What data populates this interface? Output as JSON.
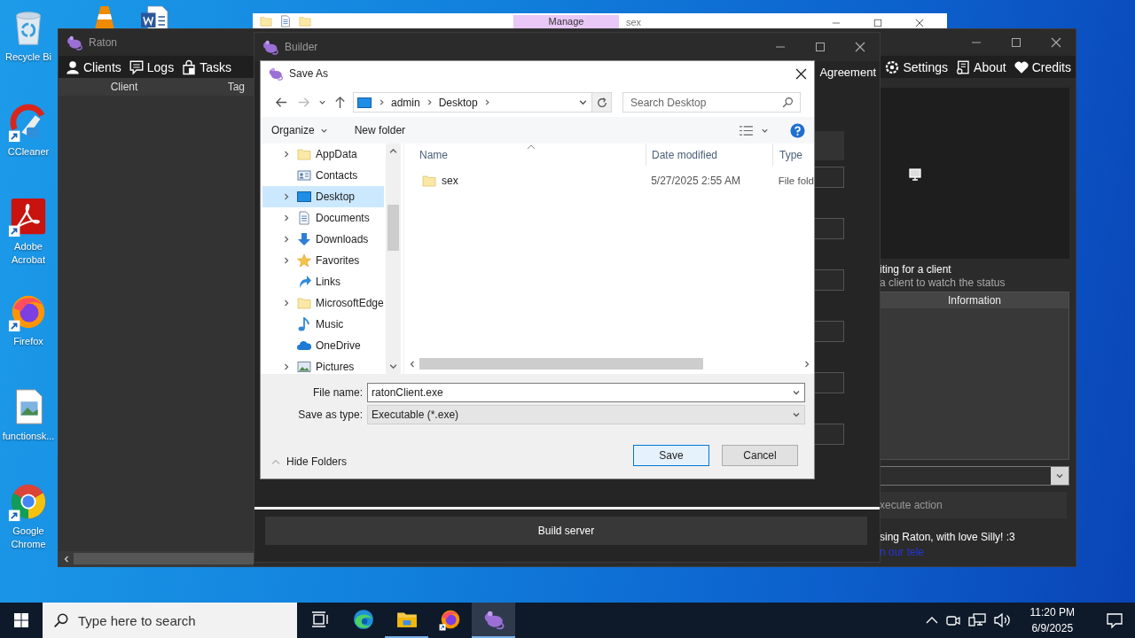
{
  "desktop_icons": [
    {
      "kind": "recycle-bin",
      "label": "Recycle Bi"
    },
    {
      "kind": "ccleaner",
      "label": "CCleaner"
    },
    {
      "kind": "acrobat",
      "label": "Adobe Acrobat"
    },
    {
      "kind": "firefox",
      "label": "Firefox"
    },
    {
      "kind": "image-file",
      "label": "functionsk..."
    },
    {
      "kind": "chrome",
      "label": "Google Chrome"
    }
  ],
  "desktop_icons_covered": [
    {
      "kind": "vlc"
    },
    {
      "kind": "word"
    }
  ],
  "explorer_window": {
    "title": "sex",
    "ribbon_tab": "Manage"
  },
  "raton_window": {
    "title": "Raton",
    "menu_left": [
      {
        "kind": "user",
        "label": "Clients"
      },
      {
        "kind": "chat",
        "label": "Logs"
      },
      {
        "kind": "bag",
        "label": "Tasks"
      }
    ],
    "menu_right": [
      {
        "kind": "gear",
        "label": "Settings"
      },
      {
        "kind": "about",
        "label": "About"
      },
      {
        "kind": "heart",
        "label": "Credits"
      }
    ],
    "client_columns": [
      "Client",
      "Tag"
    ],
    "status_title": "iting for a client",
    "status_hint": "a client to watch the status",
    "info_column": "Information",
    "action_button": "xecute action",
    "footer": "sing Raton, with love Silly! :3",
    "footer_link": "n our tele"
  },
  "builder_window": {
    "title": "Builder",
    "tab": "Agreement",
    "build_button": "Build server"
  },
  "save_dialog": {
    "title": "Save As",
    "path": [
      "admin",
      "Desktop"
    ],
    "search_placeholder": "Search Desktop",
    "toolbar": {
      "organize": "Organize",
      "new_folder": "New folder"
    },
    "nav": [
      {
        "kind": "folder",
        "label": "AppData",
        "expandable": true,
        "selected": false
      },
      {
        "kind": "contacts",
        "label": "Contacts",
        "expandable": false,
        "selected": false
      },
      {
        "kind": "desktop",
        "label": "Desktop",
        "expandable": true,
        "selected": true
      },
      {
        "kind": "documents",
        "label": "Documents",
        "expandable": true,
        "selected": false
      },
      {
        "kind": "downloads",
        "label": "Downloads",
        "expandable": true,
        "selected": false
      },
      {
        "kind": "star",
        "label": "Favorites",
        "expandable": true,
        "selected": false
      },
      {
        "kind": "links",
        "label": "Links",
        "expandable": false,
        "selected": false
      },
      {
        "kind": "folder",
        "label": "MicrosoftEdge",
        "expandable": true,
        "selected": false
      },
      {
        "kind": "music",
        "label": "Music",
        "expandable": false,
        "selected": false
      },
      {
        "kind": "cloud",
        "label": "OneDrive",
        "expandable": false,
        "selected": false
      },
      {
        "kind": "pictures",
        "label": "Pictures",
        "expandable": true,
        "selected": false
      }
    ],
    "columns": [
      "Name",
      "Date modified",
      "Type"
    ],
    "files": [
      {
        "name": "sex",
        "date": "5/27/2025 2:55 AM",
        "type": "File fold"
      }
    ],
    "file_name_label": "File name:",
    "file_name": "ratonClient.exe",
    "type_label": "Save as type:",
    "file_type": "Executable (*.exe)",
    "hide_folders": "Hide Folders",
    "save": "Save",
    "cancel": "Cancel"
  },
  "taskbar": {
    "search_placeholder": "Type here to search",
    "apps": [
      {
        "kind": "task-view",
        "running": false,
        "selected": false
      },
      {
        "kind": "edge",
        "running": false,
        "selected": false
      },
      {
        "kind": "explorer",
        "running": true,
        "selected": false
      },
      {
        "kind": "firefox",
        "running": false,
        "selected": false
      },
      {
        "kind": "raton",
        "running": true,
        "selected": true
      }
    ],
    "time": "11:20 PM",
    "date": "6/9/2025"
  }
}
